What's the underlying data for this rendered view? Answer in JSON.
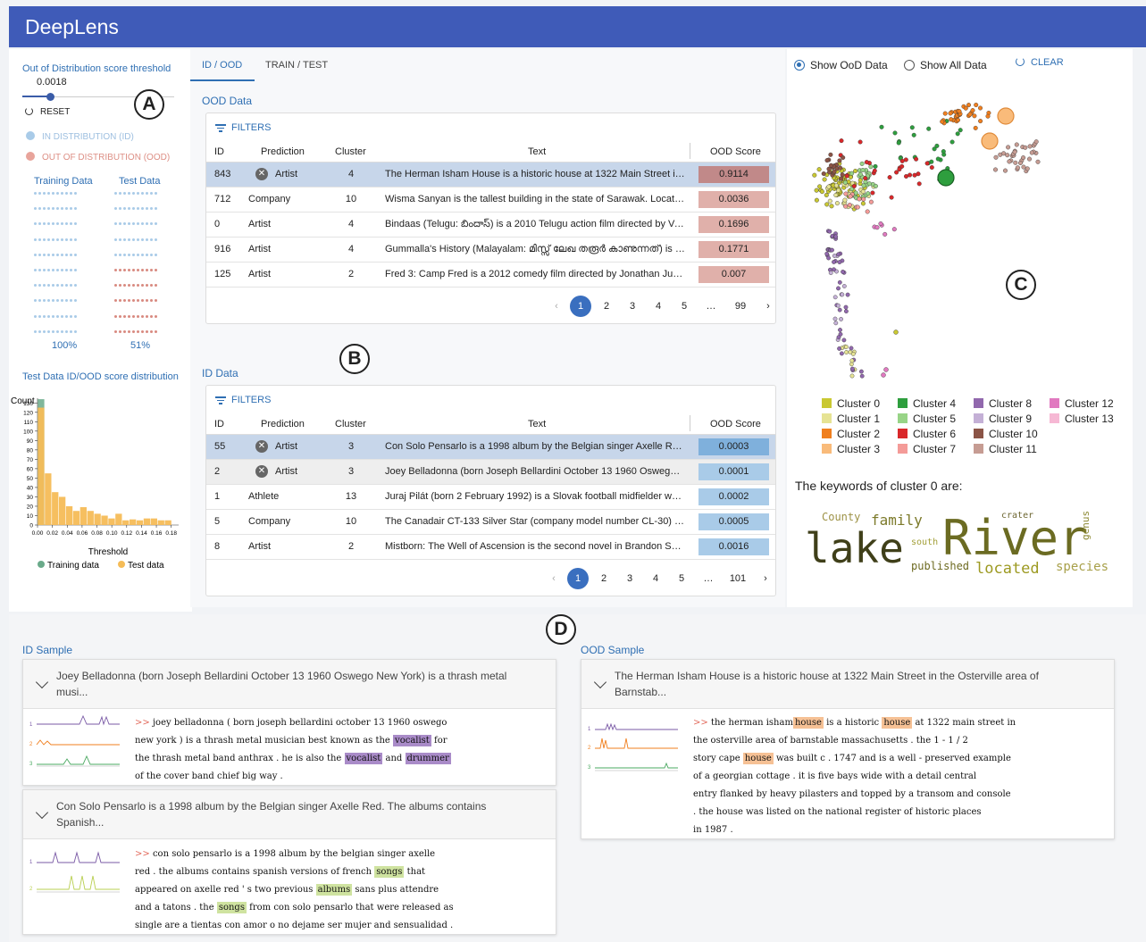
{
  "app": {
    "title": "DeepLens"
  },
  "colors": {
    "accent": "#3f5bb8",
    "link": "#2f6fb3",
    "ood": "#d88a80",
    "id": "#a9cbe8"
  },
  "panelA": {
    "threshold_label": "Out of Distribution score threshold",
    "threshold_value": "0.0018",
    "threshold_fraction": 0.18,
    "reset_label": "RESET",
    "legend_id": "IN DISTRIBUTION (ID)",
    "legend_ood": "OUT OF DISTRIBUTION (OOD)",
    "training_label": "Training Data",
    "test_label": "Test Data",
    "training_pct": "100%",
    "test_pct": "51%",
    "hist_title": "Test Data ID/OOD score distribution",
    "hist_ylabel": "Count",
    "hist_xlabel": "Threshold",
    "hist_legend_train": "Training data",
    "hist_legend_test": "Test data",
    "y_ticks": [
      "130",
      "120",
      "110",
      "100",
      "90",
      "80",
      "70",
      "60",
      "50",
      "40",
      "30",
      "20",
      "10",
      "0"
    ],
    "x_ticks": [
      "0.00",
      "0.02",
      "0.04",
      "0.06",
      "0.08",
      "0.10",
      "0.12",
      "0.14",
      "0.16",
      "0.18"
    ]
  },
  "chart_data": {
    "type": "bar",
    "title": "Test Data ID/OOD score distribution",
    "xlabel": "Threshold",
    "ylabel": "Count",
    "ylim": [
      0,
      135
    ],
    "xlim": [
      0,
      0.19
    ],
    "bin_width": 0.0095,
    "series": [
      {
        "name": "Training data",
        "color": "#6aaa8a",
        "x": [
          0.0
        ],
        "values": [
          134
        ]
      },
      {
        "name": "Test data",
        "color": "#f5bc57",
        "x": [
          0.0,
          0.0095,
          0.019,
          0.0285,
          0.038,
          0.0475,
          0.057,
          0.0665,
          0.076,
          0.0855,
          0.095,
          0.1045,
          0.114,
          0.1235,
          0.133,
          0.1425,
          0.152,
          0.1615,
          0.171
        ],
        "values": [
          125,
          55,
          35,
          30,
          20,
          15,
          19,
          15,
          12,
          10,
          7,
          12,
          5,
          6,
          5,
          7,
          7,
          5,
          5
        ]
      }
    ]
  },
  "tabs": [
    {
      "label": "ID / OOD",
      "active": true
    },
    {
      "label": "TRAIN / TEST",
      "active": false
    }
  ],
  "panelB": {
    "ood_title": "OOD Data",
    "id_title": "ID Data",
    "filters_label": "FILTERS",
    "columns": [
      "ID",
      "Prediction",
      "Cluster",
      "Text",
      "OOD Score"
    ],
    "ood_rows": [
      {
        "id": "843",
        "prediction": "Artist",
        "x": true,
        "cluster": "4",
        "text": "The Herman Isham House is a historic house at 1322 Main Street in the Osterville area",
        "score": "0.9114",
        "color": "#c18989"
      },
      {
        "id": "712",
        "prediction": "Company",
        "x": false,
        "cluster": "10",
        "text": "Wisma Sanyan is the tallest building in the state of Sarawak. Located in Sibu",
        "score": "0.0036",
        "color": "#e0b0aa"
      },
      {
        "id": "0",
        "prediction": "Artist",
        "x": false,
        "cluster": "4",
        "text": "Bindaas (Telugu: బిందాస్) is a 2010 Telugu action film directed by Veeru Potla",
        "score": "0.1696",
        "color": "#e0b0aa"
      },
      {
        "id": "916",
        "prediction": "Artist",
        "x": false,
        "cluster": "4",
        "text": "Gummalla's History (Malayalam: മിസ്സ് ലേഖ തരൂർ കാണുന്നത്) is a film",
        "score": "0.1771",
        "color": "#e0b0aa"
      },
      {
        "id": "125",
        "prediction": "Artist",
        "x": false,
        "cluster": "2",
        "text": "Fred 3: Camp Fred is a 2012 comedy film directed by Jonathan Judge",
        "score": "0.007",
        "color": "#e0b0aa"
      }
    ],
    "ood_pages": [
      "‹",
      "1",
      "2",
      "3",
      "4",
      "5",
      "…",
      "99",
      "›"
    ],
    "id_rows": [
      {
        "id": "55",
        "prediction": "Artist",
        "x": true,
        "cluster": "3",
        "text": "Con Solo Pensarlo is a 1998 album by the Belgian singer Axelle Red. The albums",
        "score": "0.0003",
        "color": "#7fb0dc"
      },
      {
        "id": "2",
        "prediction": "Artist",
        "x": true,
        "cluster": "3",
        "text": "Joey Belladonna (born Joseph Bellardini October 13 1960 Oswego New York)",
        "score": "0.0001",
        "color": "#a9cbe8"
      },
      {
        "id": "1",
        "prediction": "Athlete",
        "x": false,
        "cluster": "13",
        "text": "Juraj Pilát (born 2 February 1992) is a Slovak football midfielder who plays",
        "score": "0.0002",
        "color": "#a9cbe8"
      },
      {
        "id": "5",
        "prediction": "Company",
        "x": false,
        "cluster": "10",
        "text": "The Canadair CT-133 Silver Star (company model number CL-30) is a jet",
        "score": "0.0005",
        "color": "#a9cbe8"
      },
      {
        "id": "8",
        "prediction": "Artist",
        "x": false,
        "cluster": "2",
        "text": "Mistborn: The Well of Ascension is the second novel in Brandon Sanderson",
        "score": "0.0016",
        "color": "#a9cbe8"
      }
    ],
    "id_pages": [
      "‹",
      "1",
      "2",
      "3",
      "4",
      "5",
      "…",
      "101",
      "›"
    ]
  },
  "panelC": {
    "radio_ood": "Show OoD Data",
    "radio_all": "Show All Data",
    "clear_label": "CLEAR",
    "clusters": [
      {
        "name": "Cluster 0",
        "color": "#c9c832"
      },
      {
        "name": "Cluster 1",
        "color": "#e6e394"
      },
      {
        "name": "Cluster 2",
        "color": "#f07f1e"
      },
      {
        "name": "Cluster 3",
        "color": "#f9bb7a"
      },
      {
        "name": "Cluster 4",
        "color": "#2e9e3e"
      },
      {
        "name": "Cluster 5",
        "color": "#98d487"
      },
      {
        "name": "Cluster 6",
        "color": "#d9282a"
      },
      {
        "name": "Cluster 7",
        "color": "#f49b98"
      },
      {
        "name": "Cluster 8",
        "color": "#9168ad"
      },
      {
        "name": "Cluster 9",
        "color": "#c4b0d6"
      },
      {
        "name": "Cluster 10",
        "color": "#8b5446"
      },
      {
        "name": "Cluster 11",
        "color": "#c69c93"
      },
      {
        "name": "Cluster 12",
        "color": "#e179c0"
      },
      {
        "name": "Cluster 13",
        "color": "#f6b8d4"
      }
    ],
    "keywords_title": "The keywords of cluster 0 are:",
    "keywords": [
      "County",
      "family",
      "crater",
      "lake",
      "south",
      "River",
      "genus",
      "published",
      "located",
      "species"
    ]
  },
  "panelD": {
    "id_title": "ID Sample",
    "ood_title": "OOD Sample",
    "id_samples": [
      {
        "head1": "Joey Belladonna (born Joseph Bellardini October 13 1960 Oswego New York) is a thrash metal",
        "head2": "musi..."
      },
      {
        "head1": "Con Solo Pensarlo is a 1998 album by the Belgian singer Axelle Red. The albums contains",
        "head2": "Spanish..."
      }
    ],
    "ood_sample": {
      "head1": "The Herman Isham House is a historic house at 1322 Main Street in the Osterville area of",
      "head2": "Barnstab..."
    },
    "prefix": ">>",
    "s1": {
      "l1": "joey belladonna ( born joseph bellardini october 13 1960 oswego",
      "l2a": "new york ) is a thrash metal musician best known as the",
      "l2h": "vocalist",
      "l2b": "for",
      "l3a": "the thrash metal band anthrax . he is also the",
      "l3h1": "vocalist",
      "l3m": "and",
      "l3h2": "drummer",
      "l4": "of the cover band chief big way ."
    },
    "s2": {
      "l1": "con solo pensarlo is a 1998 album by the belgian singer axelle",
      "l2a": "red . the albums contains spanish versions of french",
      "l2h": "songs",
      "l2b": "that",
      "l3a": "appeared on axelle red ' s two previous",
      "l3h": "albums",
      "l3b": "sans plus attendre",
      "l4a": "and a tatons . the",
      "l4h": "songs",
      "l4b": "from con solo pensarlo that were released as",
      "l5": "single are a tientas con amor o no dejame ser mujer and sensualidad ."
    },
    "s3": {
      "l1a": "the herman isham",
      "l1h1": "house",
      "l1m": "is a historic",
      "l1h2": "house",
      "l1b": "at 1322 main street in",
      "l2": "the osterville area of barnstable massachusetts . the 1 - 1 / 2",
      "l3a": "story cape",
      "l3h": "house",
      "l3b": "was built c . 1747 and is a well - preserved example",
      "l4": "of a georgian cottage . it is five bays wide with a detail central",
      "l5": "entry flanked by heavy pilasters and topped by a transom and console",
      "l6": ". the house was listed on the national register of historic places",
      "l7": "in 1987 ."
    }
  },
  "labels": {
    "A": "A",
    "B": "B",
    "C": "C",
    "D": "D"
  }
}
